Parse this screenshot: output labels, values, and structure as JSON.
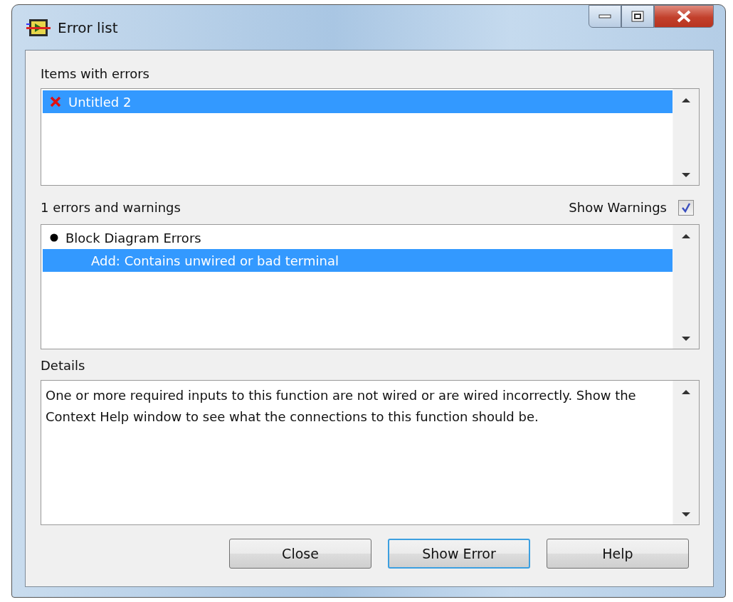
{
  "window": {
    "title": "Error list"
  },
  "items_section": {
    "label": "Items with errors",
    "items": [
      {
        "name": "Untitled 2",
        "selected": true
      }
    ]
  },
  "errors_section": {
    "count_label": "1 errors and warnings",
    "show_warnings": {
      "label": "Show Warnings",
      "checked": true
    },
    "groups": [
      {
        "label": "Block Diagram Errors",
        "selected": false,
        "children": [
          {
            "label": "Add: Contains unwired or bad terminal",
            "selected": true
          }
        ]
      }
    ]
  },
  "details": {
    "label": "Details",
    "text": "One or more required inputs to this function are not wired or are wired incorrectly. Show the Context Help window to see what the connections to this function should be."
  },
  "buttons": [
    {
      "label": "Close",
      "focused": false
    },
    {
      "label": "Show Error",
      "focused": true
    },
    {
      "label": "Help",
      "focused": false
    }
  ]
}
